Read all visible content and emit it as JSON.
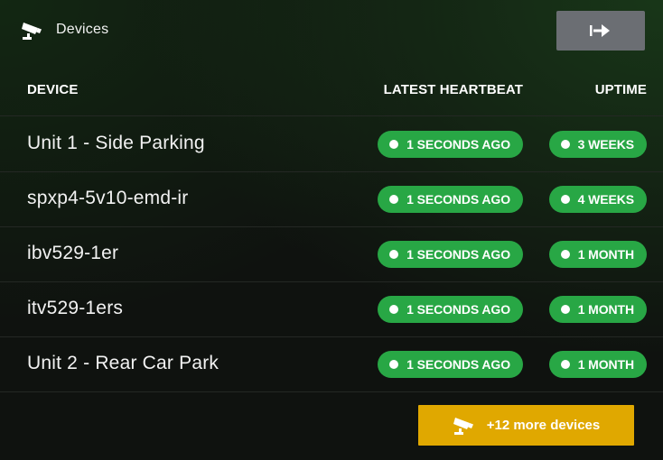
{
  "header": {
    "title": "Devices",
    "icon": "cctv-camera-icon",
    "exit_icon": "arrow-right-to-bar-icon"
  },
  "table": {
    "columns": [
      "DEVICE",
      "LATEST HEARTBEAT",
      "UPTIME"
    ],
    "rows": [
      {
        "device": "Unit 1 - Side Parking",
        "heartbeat": "1 SECONDS AGO",
        "uptime": "3 WEEKS"
      },
      {
        "device": "spxp4-5v10-emd-ir",
        "heartbeat": "1 SECONDS AGO",
        "uptime": "4 WEEKS"
      },
      {
        "device": "ibv529-1er",
        "heartbeat": "1 SECONDS AGO",
        "uptime": "1 MONTH"
      },
      {
        "device": "itv529-1ers",
        "heartbeat": "1 SECONDS AGO",
        "uptime": "1 MONTH"
      },
      {
        "device": "Unit 2 - Rear Car Park",
        "heartbeat": "1 SECONDS AGO",
        "uptime": "1 MONTH"
      }
    ]
  },
  "more_button": {
    "label": "+12 more devices",
    "icon": "cctv-camera-icon"
  },
  "colors": {
    "background": "#0f120f",
    "status_green": "#28a745",
    "button_gray": "#6b6e73",
    "button_amber": "#e0a800"
  }
}
